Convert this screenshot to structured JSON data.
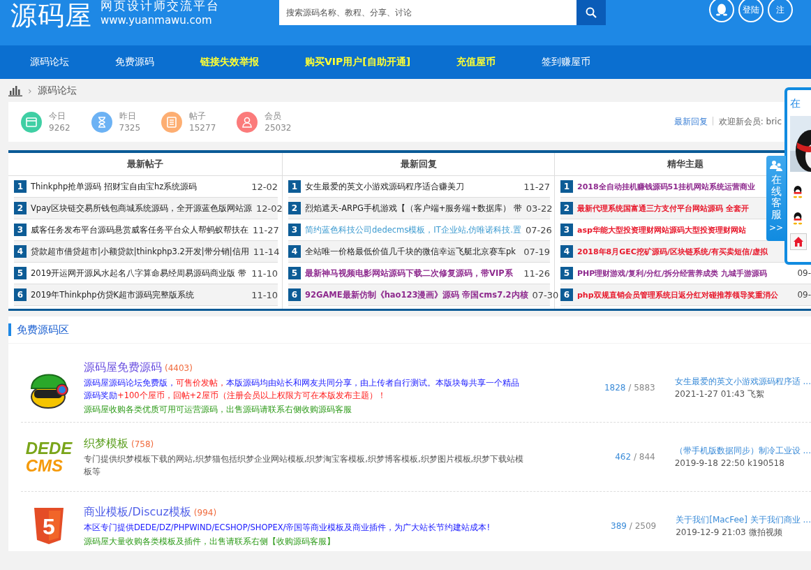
{
  "header": {
    "logo": "源码屋",
    "slogan": "网页设计师交流平台",
    "url": "www.yuanmawu.com",
    "search": {
      "placeholder": "搜索源码名称、教程、分享、讨论"
    },
    "actions": [
      {
        "kind": "qq"
      },
      {
        "kind": "text",
        "label": "登陆"
      },
      {
        "kind": "text",
        "label": "注"
      }
    ]
  },
  "nav": [
    {
      "label": "源码论坛",
      "highlight": false
    },
    {
      "label": "免费源码",
      "highlight": false
    },
    {
      "label": "链接失效举报",
      "highlight": true
    },
    {
      "label": "购买VIP用户[自助开通]",
      "highlight": true
    },
    {
      "label": "充值屋币",
      "highlight": true
    },
    {
      "label": "签到赚屋币",
      "highlight": false
    }
  ],
  "breadcrumb": {
    "separator": "›",
    "current": "源码论坛"
  },
  "stats": [
    {
      "kind": "today",
      "label": "今日",
      "value": "9262",
      "color": "#3fcfa4"
    },
    {
      "kind": "yesterday",
      "label": "昨日",
      "value": "7325",
      "color": "#6cb2f4"
    },
    {
      "kind": "posts",
      "label": "帖子",
      "value": "15277",
      "color": "#fdae72"
    },
    {
      "kind": "members",
      "label": "会员",
      "value": "25032",
      "color": "#fb7b7b"
    }
  ],
  "stats_links": {
    "latest": "最新回复",
    "separator": "|",
    "welcome": "欢迎新会员: bric"
  },
  "lists": [
    {
      "title": "最新帖子",
      "items": [
        {
          "num": "1",
          "title": "Thinkphp抢单源码 招财宝自由宝hz系统源码",
          "date": "12-02",
          "color": "#222222",
          "bold": false
        },
        {
          "num": "2",
          "title": "Vpay区块链交易所钱包商城系统源码，全开源蓝色版网站源",
          "date": "12-02",
          "color": "#222222",
          "bold": false
        },
        {
          "num": "3",
          "title": "威客任务发布平台源码悬赏威客任务平台众人帮蚂蚁帮扶在",
          "date": "11-27",
          "color": "#222222",
          "bold": false
        },
        {
          "num": "4",
          "title": "贷款超市借贷超市|小额贷款|thinkphp3.2开发|带分销|信用",
          "date": "11-14",
          "color": "#222222",
          "bold": false
        },
        {
          "num": "5",
          "title": "2019开运网开源风水起名八字算命易经周易源码商业版 带",
          "date": "11-10",
          "color": "#222222",
          "bold": false
        },
        {
          "num": "6",
          "title": "2019年Thinkphp仿贷K超市源码完整版系统",
          "date": "11-10",
          "color": "#222222",
          "bold": false
        }
      ]
    },
    {
      "title": "最新回复",
      "items": [
        {
          "num": "1",
          "title": "女生最爱的英文小游戏源码程序适合赚美刀",
          "date": "11-27",
          "color": "#222222",
          "bold": false
        },
        {
          "num": "2",
          "title": "烈焰遮天-ARPG手机游戏【（客户端+服务端+数据库） 带",
          "date": "03-22",
          "color": "#222222",
          "bold": false
        },
        {
          "num": "3",
          "title": "简约蓝色科技公司dedecms模板，IT企业站,仿唯诺科技.置",
          "date": "07-26",
          "color": "#3d9bd0",
          "bold": false
        },
        {
          "num": "4",
          "title": "全站唯一价格最低价值几千块的微信幸运飞艇北京赛车pk",
          "date": "07-19",
          "color": "#222222",
          "bold": false
        },
        {
          "num": "5",
          "title": "最新神马视频电影网站源码下载二次修复源码，带VIP系",
          "date": "11-26",
          "color": "#8e2a8e",
          "bold": true
        },
        {
          "num": "6",
          "title": "92GAME最新仿制《hao123漫画》源码 帝国cms7.2内核",
          "date": "07-30",
          "color": "#8e2a8e",
          "bold": true
        }
      ]
    },
    {
      "title": "精华主题",
      "items": [
        {
          "num": "1",
          "title": "2018全自动挂机赚钱源码51挂机网站系统运营商业",
          "color": "#8e2a8e",
          "bold": true
        },
        {
          "num": "2",
          "title": "最新代理系统国富通三方支付平台网站源码 全套开",
          "color": "#e8192c",
          "bold": true
        },
        {
          "num": "3",
          "title": "asp华能大型投资理财网站源码大型投资理财网站",
          "color": "#e8192c",
          "bold": true
        },
        {
          "num": "4",
          "title": "2018年8月GEC挖矿源码/区块链系统/有买卖短信/虚拟",
          "color": "#e8192c",
          "bold": true
        },
        {
          "num": "5",
          "title": "PHP理财游戏/复利/分红/拆分经营养成类 九城手游源码",
          "date": "09-",
          "color": "#8e2a8e",
          "bold": true
        },
        {
          "num": "6",
          "title": "php双规直销会员管理系统日返分红对碰推荐领导奖重消公",
          "date": "09-",
          "color": "#e8192c",
          "bold": true
        }
      ]
    }
  ],
  "section": {
    "title": "免费源码区",
    "forums": [
      {
        "logo": {
          "kind": "mascot"
        },
        "name": "源码屋免费源码",
        "color": "#6a4fe0",
        "count": "(4403)",
        "description": [
          [
            {
              "text": "源码屋源码论坛免费版，",
              "color": "#1a1aff"
            },
            {
              "text": "可售价发帖，",
              "color": "#ff1a1a"
            },
            {
              "text": "本版源码均由站长和网友共同分享，由上传者自行测试。本版块每共享一个精品源码奖励",
              "color": "#1a1aff"
            },
            {
              "text": "+100个屋币，回帖+2屋币（注册会员以上权限方可在本版发布主题）！",
              "color": "#ff1a1a"
            }
          ],
          [
            {
              "text": "源码屋收购各类优质可用可运营源码，出售源码请联系右侧收购源码客服",
              "color": "#2e9b1a"
            }
          ]
        ],
        "threads": "1828",
        "separator": "/",
        "posts": "5883",
        "last_title": "女生最爱的英文小游戏源码程序适 ...",
        "last_meta": "2021-1-27 01:43 飞絮"
      },
      {
        "logo": {
          "kind": "wordmark",
          "lines": [
            "DEDE",
            "CMS"
          ]
        },
        "name": "织梦模板",
        "color": "#5a9e1e",
        "count": "(758)",
        "description": [
          [
            {
              "text": "专门提供织梦模板下载的网站,织梦猫包括织梦企业网站模板,织梦淘宝客模板,织梦博客模板,织梦图片模板,织梦下载站模板等",
              "color": "#555555"
            }
          ]
        ],
        "threads": "462",
        "separator": "/",
        "posts": "844",
        "last_title": "（带手机版数据同步）制冷工业设 ...",
        "last_meta": "2019-9-18 22:50 k190518"
      },
      {
        "logo": {
          "kind": "shield",
          "text": "5"
        },
        "name": "商业模板/Discuz模板",
        "color": "#4f5fe8",
        "count": "(994)",
        "description": [
          [
            {
              "text": "本区专门提供DEDE/DZ/PHPWIND/ECSHOP/SHOPEX/帝国等商业模板及商业插件，为广大站长节约建站成本!",
              "color": "#1a1aff"
            }
          ],
          [
            {
              "text": "源码屋大量收购各类模板及插件，出售请联系右侧【收购源码客服】",
              "color": "#2e9b1a"
            }
          ]
        ],
        "threads": "389",
        "separator": "/",
        "posts": "2509",
        "last_title": "关于我们[MacFee] 关于我们商业 ...",
        "last_meta": "2019-12-9 21:03 微拍视频"
      }
    ]
  },
  "service": {
    "tab_label": "在线客服",
    "tab_arrow": ">>",
    "panel_title": "在",
    "contacts": [
      {
        "kind": "qq"
      },
      {
        "kind": "qq"
      },
      {
        "kind": "home"
      }
    ]
  }
}
